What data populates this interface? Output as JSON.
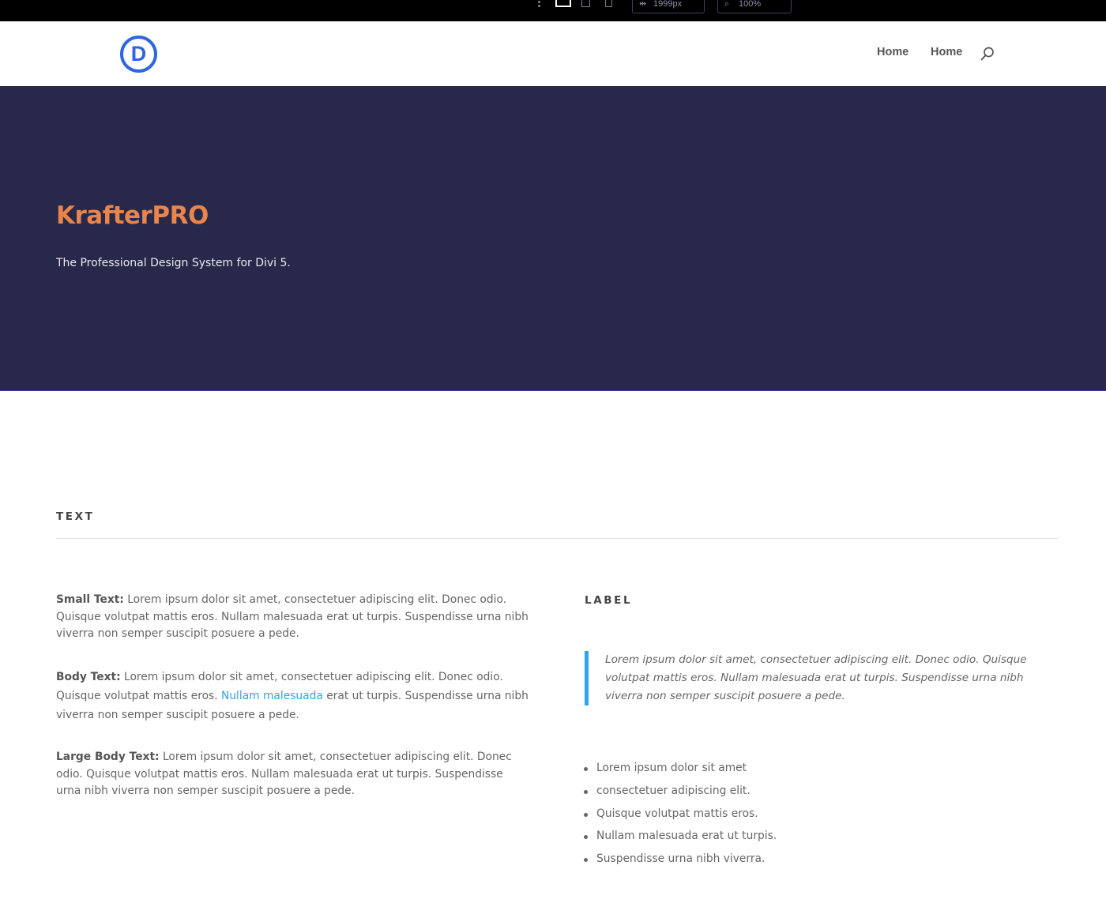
{
  "builder_toolbar": {
    "width_value": "1999px",
    "zoom_value": "100%",
    "icons": [
      "more-dots-icon",
      "desktop-view-icon",
      "tablet-view-icon",
      "phone-view-icon",
      "width-icon",
      "zoom-icon"
    ]
  },
  "header": {
    "logo_letter": "D",
    "nav": [
      {
        "label": "Home"
      },
      {
        "label": "Home"
      }
    ],
    "colors": {
      "logo": "#2f65e0"
    }
  },
  "hero": {
    "title": "KrafterPRO",
    "subtitle": "The Professional Design System for Divi 5.",
    "colors": {
      "background": "#28284a",
      "title": "#e9854a"
    }
  },
  "content": {
    "section_label": "TEXT",
    "small_text": {
      "label": "Small Text:",
      "text": " Lorem ipsum dolor sit amet, consectetuer adipiscing elit. Donec odio. Quisque volutpat mattis eros. Nullam malesuada erat ut turpis. Suspendisse urna nibh viverra non semper suscipit posuere a pede."
    },
    "body_text": {
      "label": "Body Text:",
      "before_link": " Lorem ipsum dolor sit amet, consectetuer adipiscing elit. Donec odio. Quisque volutpat mattis eros. ",
      "link": "Nullam malesuada",
      "after_link": " erat ut turpis. Suspendisse urna nibh viverra non semper suscipit posuere a pede."
    },
    "large_text": {
      "label": "Large Body Text:",
      "text": " Lorem ipsum dolor sit amet, consectetuer adipiscing elit. Donec odio. Quisque volutpat mattis eros. Nullam malesuada erat ut turpis. Suspendisse urna nibh viverra non semper suscipit posuere a pede."
    },
    "label_heading": "LABEL",
    "blockquote": "Lorem ipsum dolor sit amet, consectetuer adipiscing elit. Donec odio. Quisque volutpat mattis eros. Nullam malesuada erat ut turpis. Suspendisse urna nibh viverra non semper suscipit posuere a pede.",
    "list": [
      "Lorem ipsum dolor sit amet",
      "consectetuer adipiscing elit.",
      "Quisque volutpat mattis eros.",
      "Nullam malesuada erat ut turpis.",
      "Suspendisse urna nibh viverra."
    ],
    "colors": {
      "link": "#2ea3f2",
      "quote_border": "#2ea3f2"
    }
  }
}
